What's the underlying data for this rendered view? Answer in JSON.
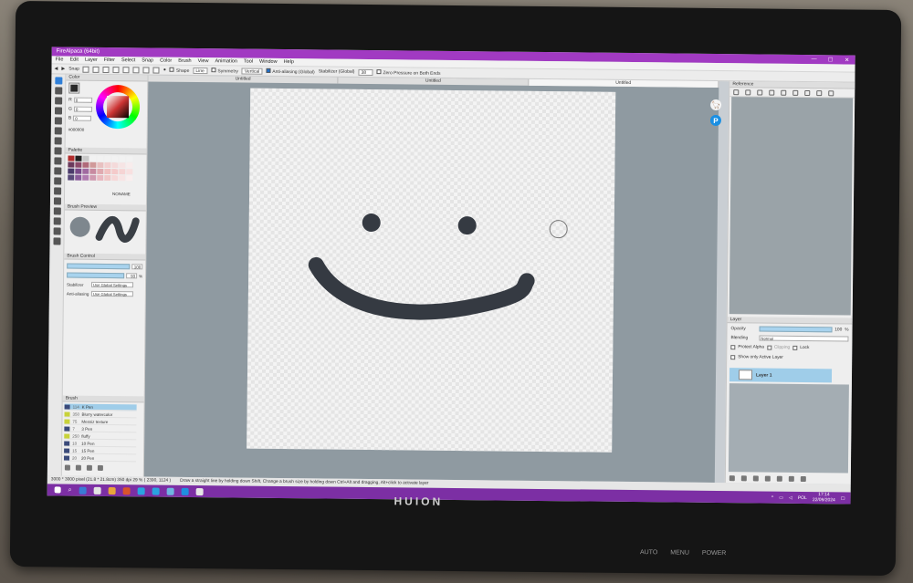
{
  "window": {
    "title": "FireAlpaca (64bit)",
    "controls": [
      "—",
      "☐",
      "✕"
    ]
  },
  "menu": [
    "File",
    "Edit",
    "Layer",
    "Filter",
    "Select",
    "Snap",
    "Color",
    "Brush",
    "View",
    "Animation",
    "Tool",
    "Window",
    "Help"
  ],
  "toolbar": {
    "snap_label": "Snap",
    "shape_label": "Shape",
    "shape_value": "Line",
    "symmetry_label": "Symmetry",
    "symmetry_value": "Vertical",
    "antialias_label": "Anti-aliasing (Global)",
    "stabilizer_label": "Stabilizer (Global)",
    "stabilizer_value": "38",
    "zero_pressure_label": "Zero Pressure on Both Ends"
  },
  "tabs": [
    "Untitled",
    "Untitled",
    "Untitled"
  ],
  "color_panel": {
    "title": "Color",
    "r_label": "R",
    "r": "0",
    "g_label": "G",
    "g": "0",
    "b_label": "B",
    "b": "0",
    "hex": "#000000",
    "fg": "#2a2a2a"
  },
  "palette_panel": {
    "title": "Palette",
    "name": "NONAME",
    "swatches": [
      "#b22d2d",
      "#222222",
      "#c8c8c8",
      "#f2f2f2",
      "#f2f2f2",
      "#f2f2f2",
      "#f2f2f2",
      "#f2f2f2",
      "#f2f2f2",
      "#6b3a5c",
      "#8c4a6a",
      "#b06a7a",
      "#d19a9a",
      "#e8c0c0",
      "#f2d0d0",
      "#f4dada",
      "#f6e4e4",
      "#f8ecec",
      "#4a3a6a",
      "#7a4a8a",
      "#a06aa0",
      "#c88aa0",
      "#e0aab0",
      "#f0c0c0",
      "#f4caca",
      "#f6d4d4",
      "#f8e0e0",
      "#5a4a7a",
      "#8a5a9a",
      "#b07ab0",
      "#d09ab0",
      "#e8b8c0",
      "#f0c8c8",
      "#f6d8d8",
      "#f8e4e4",
      "#faeeee"
    ]
  },
  "brush_preview": {
    "title": "Brush Preview"
  },
  "brush_control": {
    "title": "Brush Control",
    "size": "100",
    "opacity": "93",
    "opacity_unit": "%",
    "stabilizer_label": "Stabilizer",
    "stabilizer_value": "Use Global Settings",
    "antialias_label": "Anti-aliasing",
    "antialias_value": "Use Global Settings"
  },
  "brush_list": {
    "title": "Brush",
    "items": [
      {
        "size": "114",
        "name": "K Pen",
        "color": "#3a4a7a",
        "selected": true
      },
      {
        "size": "350",
        "name": "Blurry watercolor",
        "color": "#c8d23a",
        "selected": false
      },
      {
        "size": "75",
        "name": "Messiz texture",
        "color": "#c8d23a",
        "selected": false
      },
      {
        "size": "7",
        "name": "3 Pen",
        "color": "#3a4a7a",
        "selected": false
      },
      {
        "size": "250",
        "name": "fluffy",
        "color": "#c8d23a",
        "selected": false
      },
      {
        "size": "10",
        "name": "10 Pen",
        "color": "#3a4a7a",
        "selected": false
      },
      {
        "size": "15",
        "name": "15 Pen",
        "color": "#3a4a7a",
        "selected": false
      },
      {
        "size": "20",
        "name": "20 Pen",
        "color": "#3a4a7a",
        "selected": false
      }
    ]
  },
  "reference_panel": {
    "title": "Reference"
  },
  "layer_panel": {
    "title": "Layer",
    "opacity_label": "Opacity",
    "opacity_value": "100",
    "opacity_unit": "%",
    "blending_label": "Blending",
    "blending_value": "Normal",
    "protect_alpha": "Protect Alpha",
    "clipping": "Clipping",
    "lock": "Lock",
    "show_only_active": "Show only Active Layer",
    "layer_name": "Layer 1"
  },
  "status": {
    "size_info": "3000 * 3000 pixel  (21.8 * 21.8cm)  350 dpi  29 %  ( 2390, 1124 )",
    "hint": "Draw a straight line by holding down Shift, Change a brush size by holding down Ctrl+Alt and dragging, Alt+click to activate layer"
  },
  "taskbar": {
    "lang": "POL",
    "time": "17:14",
    "date": "22/09/2024",
    "icons": [
      "#3a7bd5",
      "#e3e3e3",
      "#e8a53a",
      "#d9542b",
      "#2aa3e0",
      "#2aa3e0",
      "#6fb5e0",
      "#1f8fe0",
      "#e6e6e6"
    ]
  },
  "bezel": {
    "brand": "HUION",
    "labels": [
      "AUTO",
      "MENU",
      "POWER"
    ]
  }
}
